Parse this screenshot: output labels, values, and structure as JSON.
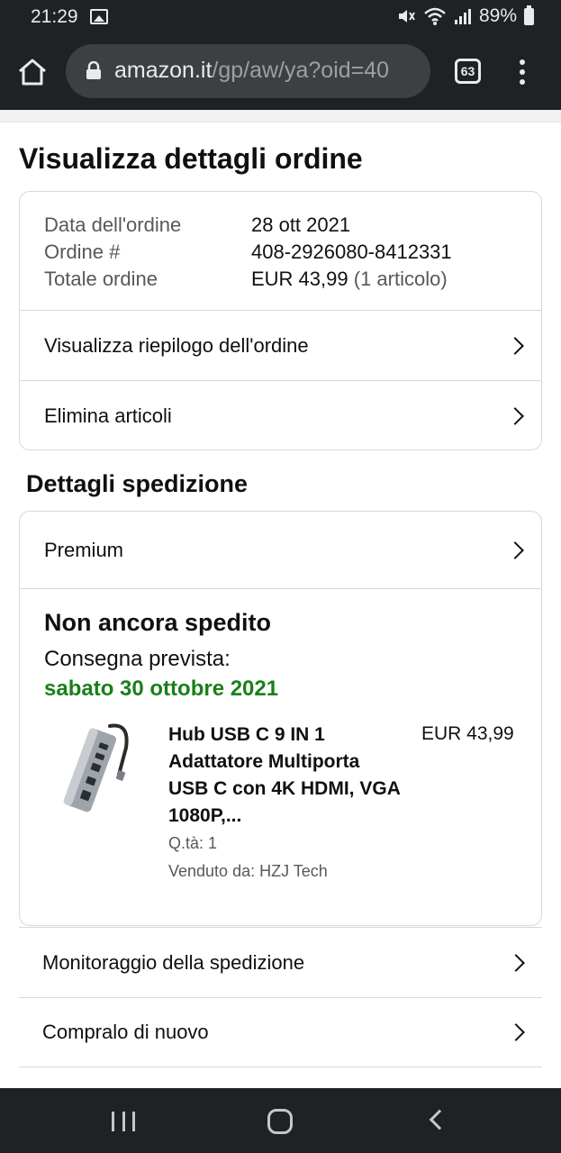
{
  "status_bar": {
    "time": "21:29",
    "battery": "89%",
    "icons": [
      "image-icon",
      "mute-icon",
      "wifi-icon",
      "signal-icon",
      "battery-icon"
    ]
  },
  "browser": {
    "url_domain": "amazon.it",
    "url_path": "/gp/aw/ya?oid=40",
    "tab_count": "63"
  },
  "page": {
    "title": "Visualizza dettagli ordine"
  },
  "order": {
    "rows": [
      {
        "label": "Data dell'ordine",
        "value": "28 ott 2021"
      },
      {
        "label": "Ordine #",
        "value": "408-2926080-8412331"
      }
    ],
    "total_label": "Totale ordine",
    "total_value": "EUR 43,99",
    "total_items": "(1 articolo)",
    "links": [
      "Visualizza riepilogo dell'ordine",
      "Elimina articoli"
    ]
  },
  "shipping": {
    "section_title": "Dettagli spedizione",
    "method": "Premium",
    "status": "Non ancora spedito",
    "delivery_label": "Consegna prevista:",
    "delivery_date": "sabato 30 ottobre 2021",
    "delivery_color": "#1a7f1a",
    "product": {
      "title": "Hub USB C 9 IN 1 Adattatore Multiporta USB C con 4K HDMI, VGA 1080P,...",
      "price": "EUR 43,99",
      "qty": "Q.tà: 1",
      "seller": "Venduto da: HZJ Tech"
    },
    "actions": [
      "Monitoraggio della spedizione",
      "Compralo di nuovo"
    ]
  }
}
